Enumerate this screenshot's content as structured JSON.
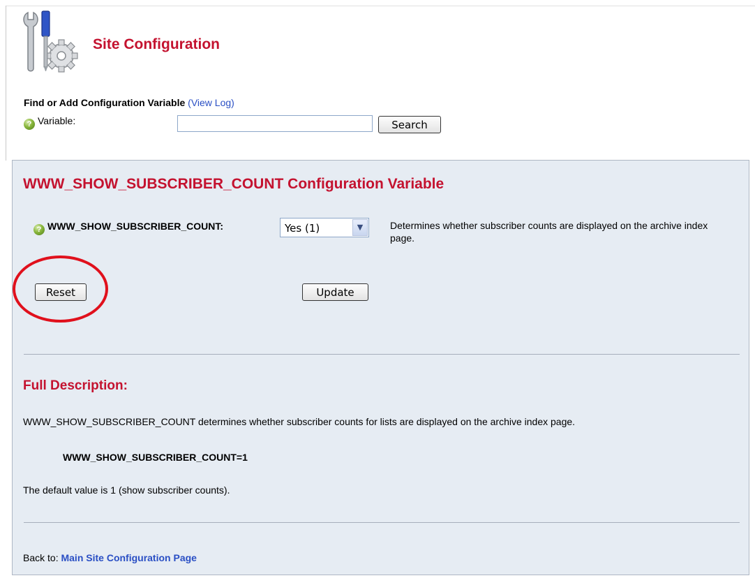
{
  "header": {
    "title": "Site Configuration",
    "icon": "tools-gear-icon"
  },
  "find": {
    "heading": "Find or Add Configuration Variable",
    "view_log": "(View Log)",
    "variable_label": "Variable:",
    "variable_value": "",
    "search_label": "Search"
  },
  "panel": {
    "title": "WWW_SHOW_SUBSCRIBER_COUNT Configuration Variable",
    "variable_label": "WWW_SHOW_SUBSCRIBER_COUNT:",
    "selected_value": "Yes (1)",
    "short_description": "Determines whether subscriber counts are displayed on the archive index page.",
    "reset_label": "Reset",
    "update_label": "Update",
    "full_description_title": "Full Description:",
    "full_description_text": "WWW_SHOW_SUBSCRIBER_COUNT determines whether subscriber counts for lists are displayed on the archive index page.",
    "code_line": "WWW_SHOW_SUBSCRIBER_COUNT=1",
    "default_line": "The default value is 1 (show subscriber counts).",
    "back_prefix": "Back to:",
    "back_link": "Main Site Configuration Page"
  },
  "colors": {
    "accent_red": "#c4122f",
    "link_blue": "#2a4fc4",
    "panel_bg": "#e6ecf3",
    "highlight_circle": "#e0101c"
  }
}
